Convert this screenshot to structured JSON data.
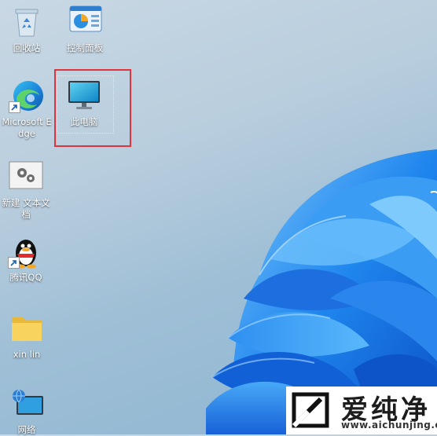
{
  "desktop": {
    "icons": [
      {
        "label": "回收站"
      },
      {
        "label": "控制面板"
      },
      {
        "label": "Microsoft Edge"
      },
      {
        "label": "此电脑"
      },
      {
        "label": "新建 文本文档"
      },
      {
        "label": "腾讯QQ"
      },
      {
        "label": "xin lin"
      },
      {
        "label": "网络"
      }
    ]
  },
  "watermark": {
    "title": "爱纯净",
    "url": "www.aichunjing.com"
  },
  "colors": {
    "highlight": "#e0343a",
    "bloom_primary": "#1a73e8",
    "bloom_light": "#4fa8f5"
  }
}
